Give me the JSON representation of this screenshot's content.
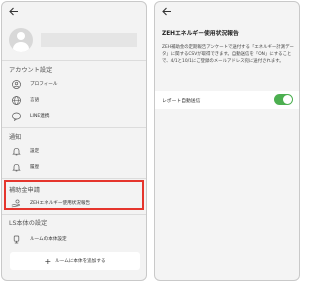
{
  "left_screen": {
    "back_icon": "arrow-left-icon",
    "sections": {
      "account": {
        "label": "アカウント設定",
        "items": [
          {
            "label": "プロフィール",
            "icon": "user-circle-icon"
          },
          {
            "label": "言語",
            "icon": "globe-icon"
          },
          {
            "label": "LINE連携",
            "icon": "link-icon"
          }
        ]
      },
      "notification": {
        "label": "通知",
        "items": [
          {
            "label": "設定",
            "icon": "bell-icon"
          },
          {
            "label": "履歴",
            "icon": "bell-outline-icon"
          }
        ]
      },
      "subsidy": {
        "label": "補助金申請",
        "items": [
          {
            "label": "ZEHエネルギー使用状況報告",
            "icon": "hand-coin-icon"
          }
        ]
      },
      "device": {
        "label": "LS本体の設定",
        "items": [
          {
            "label": "ルームの本体設定",
            "icon": "device-icon"
          }
        ]
      }
    },
    "add_button": {
      "label": "ルームに本体を追加する",
      "icon": "plus-icon"
    },
    "highlight_color": "#e5352d"
  },
  "right_screen": {
    "back_icon": "arrow-left-icon",
    "title": "ZEHエネルギー使用状況報告",
    "description": "ZEH補助金の定期報告アンケートで送付する「エネルギー計測データ」に関するCSVが取得できます。自動送信を「ON」にすることで、4/1と10/1にご登録のメールアドレス宛に送付されます。",
    "toggle": {
      "label": "レポート自動送信",
      "state": "on",
      "color": "#4caf50"
    }
  }
}
